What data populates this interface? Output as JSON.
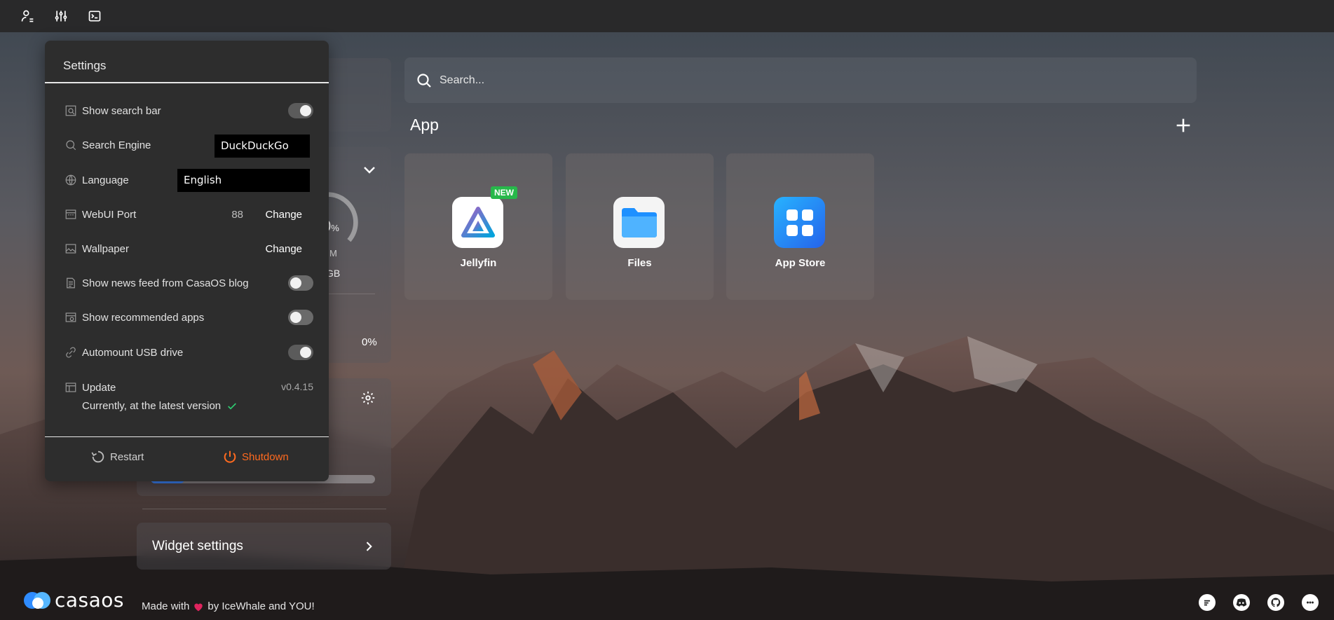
{
  "topbar": {
    "icons": [
      "user-settings-icon",
      "sliders-icon",
      "terminal-icon"
    ]
  },
  "search": {
    "placeholder": "Search..."
  },
  "app_section": {
    "heading": "App"
  },
  "apps": [
    {
      "name": "Jellyfin",
      "badge": "NEW",
      "icon": "jellyfin-icon"
    },
    {
      "name": "Files",
      "icon": "folder-icon"
    },
    {
      "name": "App Store",
      "icon": "app-store-icon"
    }
  ],
  "widgets": {
    "gauge_value": "0",
    "gauge_unit": "%",
    "gauge_sub1": "M",
    "gauge_sub2": "GB",
    "percent": "0%",
    "widget_settings_label": "Widget settings",
    "progress": 0.15
  },
  "settings": {
    "title": "Settings",
    "show_search_bar": {
      "label": "Show search bar",
      "enabled": true
    },
    "search_engine": {
      "label": "Search Engine",
      "value": "DuckDuckGo"
    },
    "language": {
      "label": "Language",
      "value": "English"
    },
    "webui_port": {
      "label": "WebUI Port",
      "value": "88",
      "action": "Change"
    },
    "wallpaper": {
      "label": "Wallpaper",
      "action": "Change"
    },
    "news_feed": {
      "label": "Show news feed from CasaOS blog",
      "enabled": false
    },
    "recommended_apps": {
      "label": "Show recommended apps",
      "enabled": false
    },
    "automount_usb": {
      "label": "Automount USB drive",
      "enabled": true
    },
    "update": {
      "label": "Update",
      "version": "v0.4.15",
      "status": "Currently, at the latest version"
    },
    "restart_label": "Restart",
    "shutdown_label": "Shutdown"
  },
  "footer": {
    "logo_text": "casaos",
    "made_with_prefix": "Made with",
    "made_with_suffix": "by IceWhale and YOU!",
    "icons": [
      "feedback-icon",
      "discord-icon",
      "github-icon",
      "chat-icon"
    ]
  },
  "colors": {
    "accent_blue": "#3b82f6",
    "shutdown_orange": "#ff6a1f",
    "new_badge_green": "#27b84a"
  }
}
